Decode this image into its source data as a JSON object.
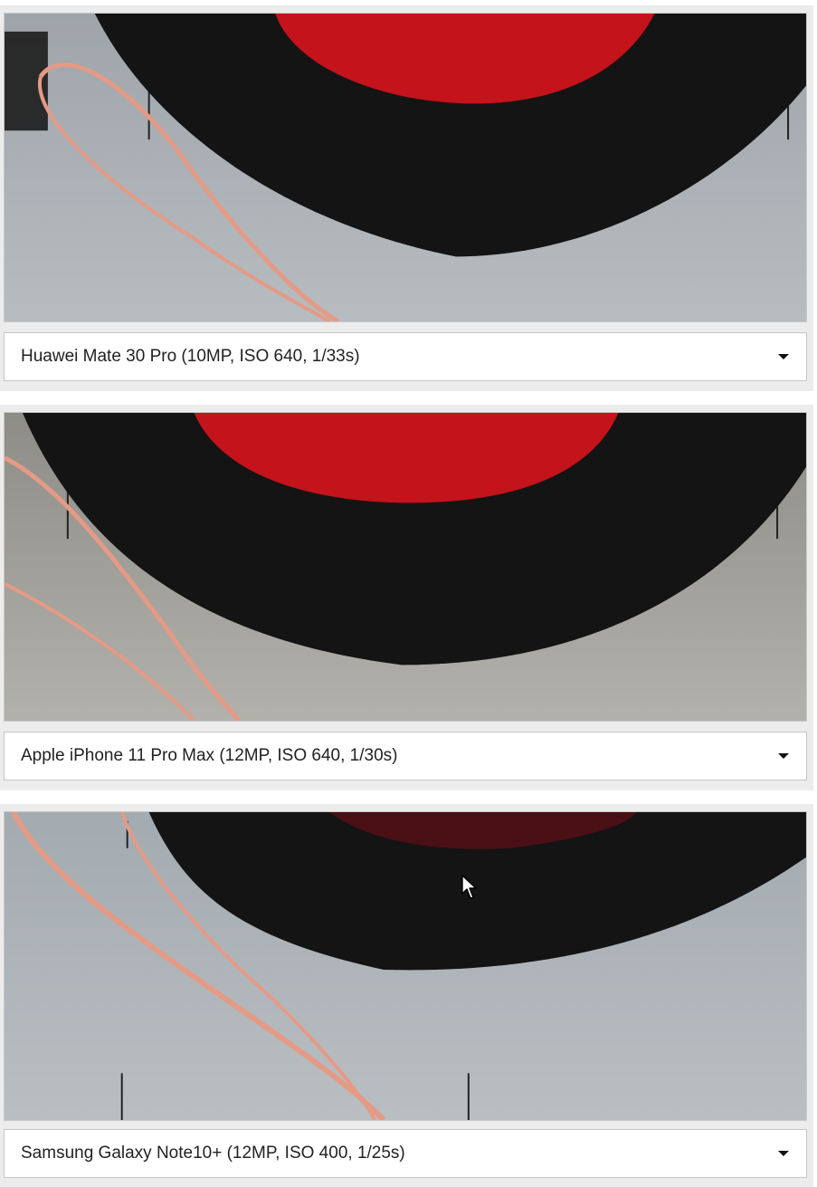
{
  "comparisons": [
    {
      "camera_select": {
        "selected": "Huawei Mate 30 Pro (10MP, ISO 640, 1/33s)"
      },
      "crop_icon": "lace-crop-image"
    },
    {
      "camera_select": {
        "selected": "Apple iPhone 11 Pro Max (12MP, ISO 640, 1/30s)"
      },
      "crop_icon": "lace-crop-image"
    },
    {
      "camera_select": {
        "selected": "Samsung Galaxy Note10+ (12MP, ISO 400, 1/25s)"
      },
      "crop_icon": "lace-crop-image"
    }
  ],
  "colors": {
    "panel_bg": "#ececec",
    "backdrop_gray": "#a9b0b5",
    "fabric_red": "#c4131b",
    "lace_black": "#141414",
    "thread_pink": "#e59a86"
  },
  "pointer_icon": "mouse-pointer-icon"
}
